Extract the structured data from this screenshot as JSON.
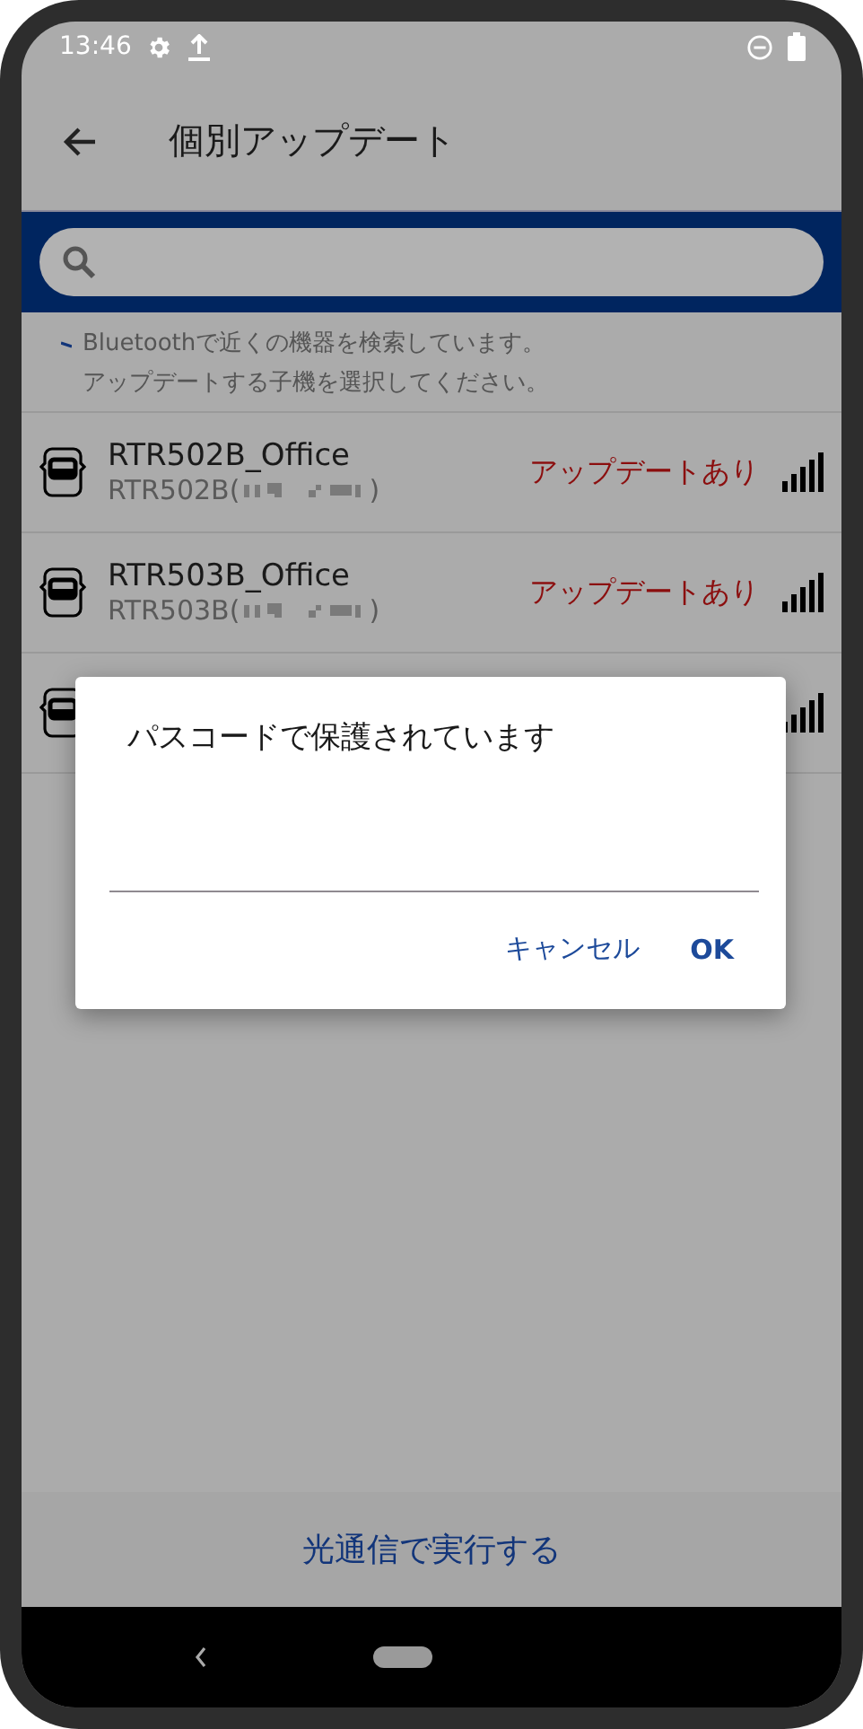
{
  "status_bar": {
    "time": "13:46"
  },
  "app_bar": {
    "title": "個別アップデート"
  },
  "info": {
    "lines": [
      "Bluetoothで近くの機器を検索しています。",
      "アップデートする子機を選択してください。"
    ]
  },
  "devices": [
    {
      "name": "RTR502B_Office",
      "model_prefix": "RTR502B(",
      "model_suffix": ")",
      "status": "アップデートあり"
    },
    {
      "name": "RTR503B_Office",
      "model_prefix": "RTR503B(",
      "model_suffix": ")",
      "status": "アップデートあり"
    }
  ],
  "dialog": {
    "title": "パスコードで保護されています",
    "buttons": [
      "キャンセル",
      "OK"
    ]
  },
  "bottom_button": {
    "label": "光通信で実行する"
  }
}
